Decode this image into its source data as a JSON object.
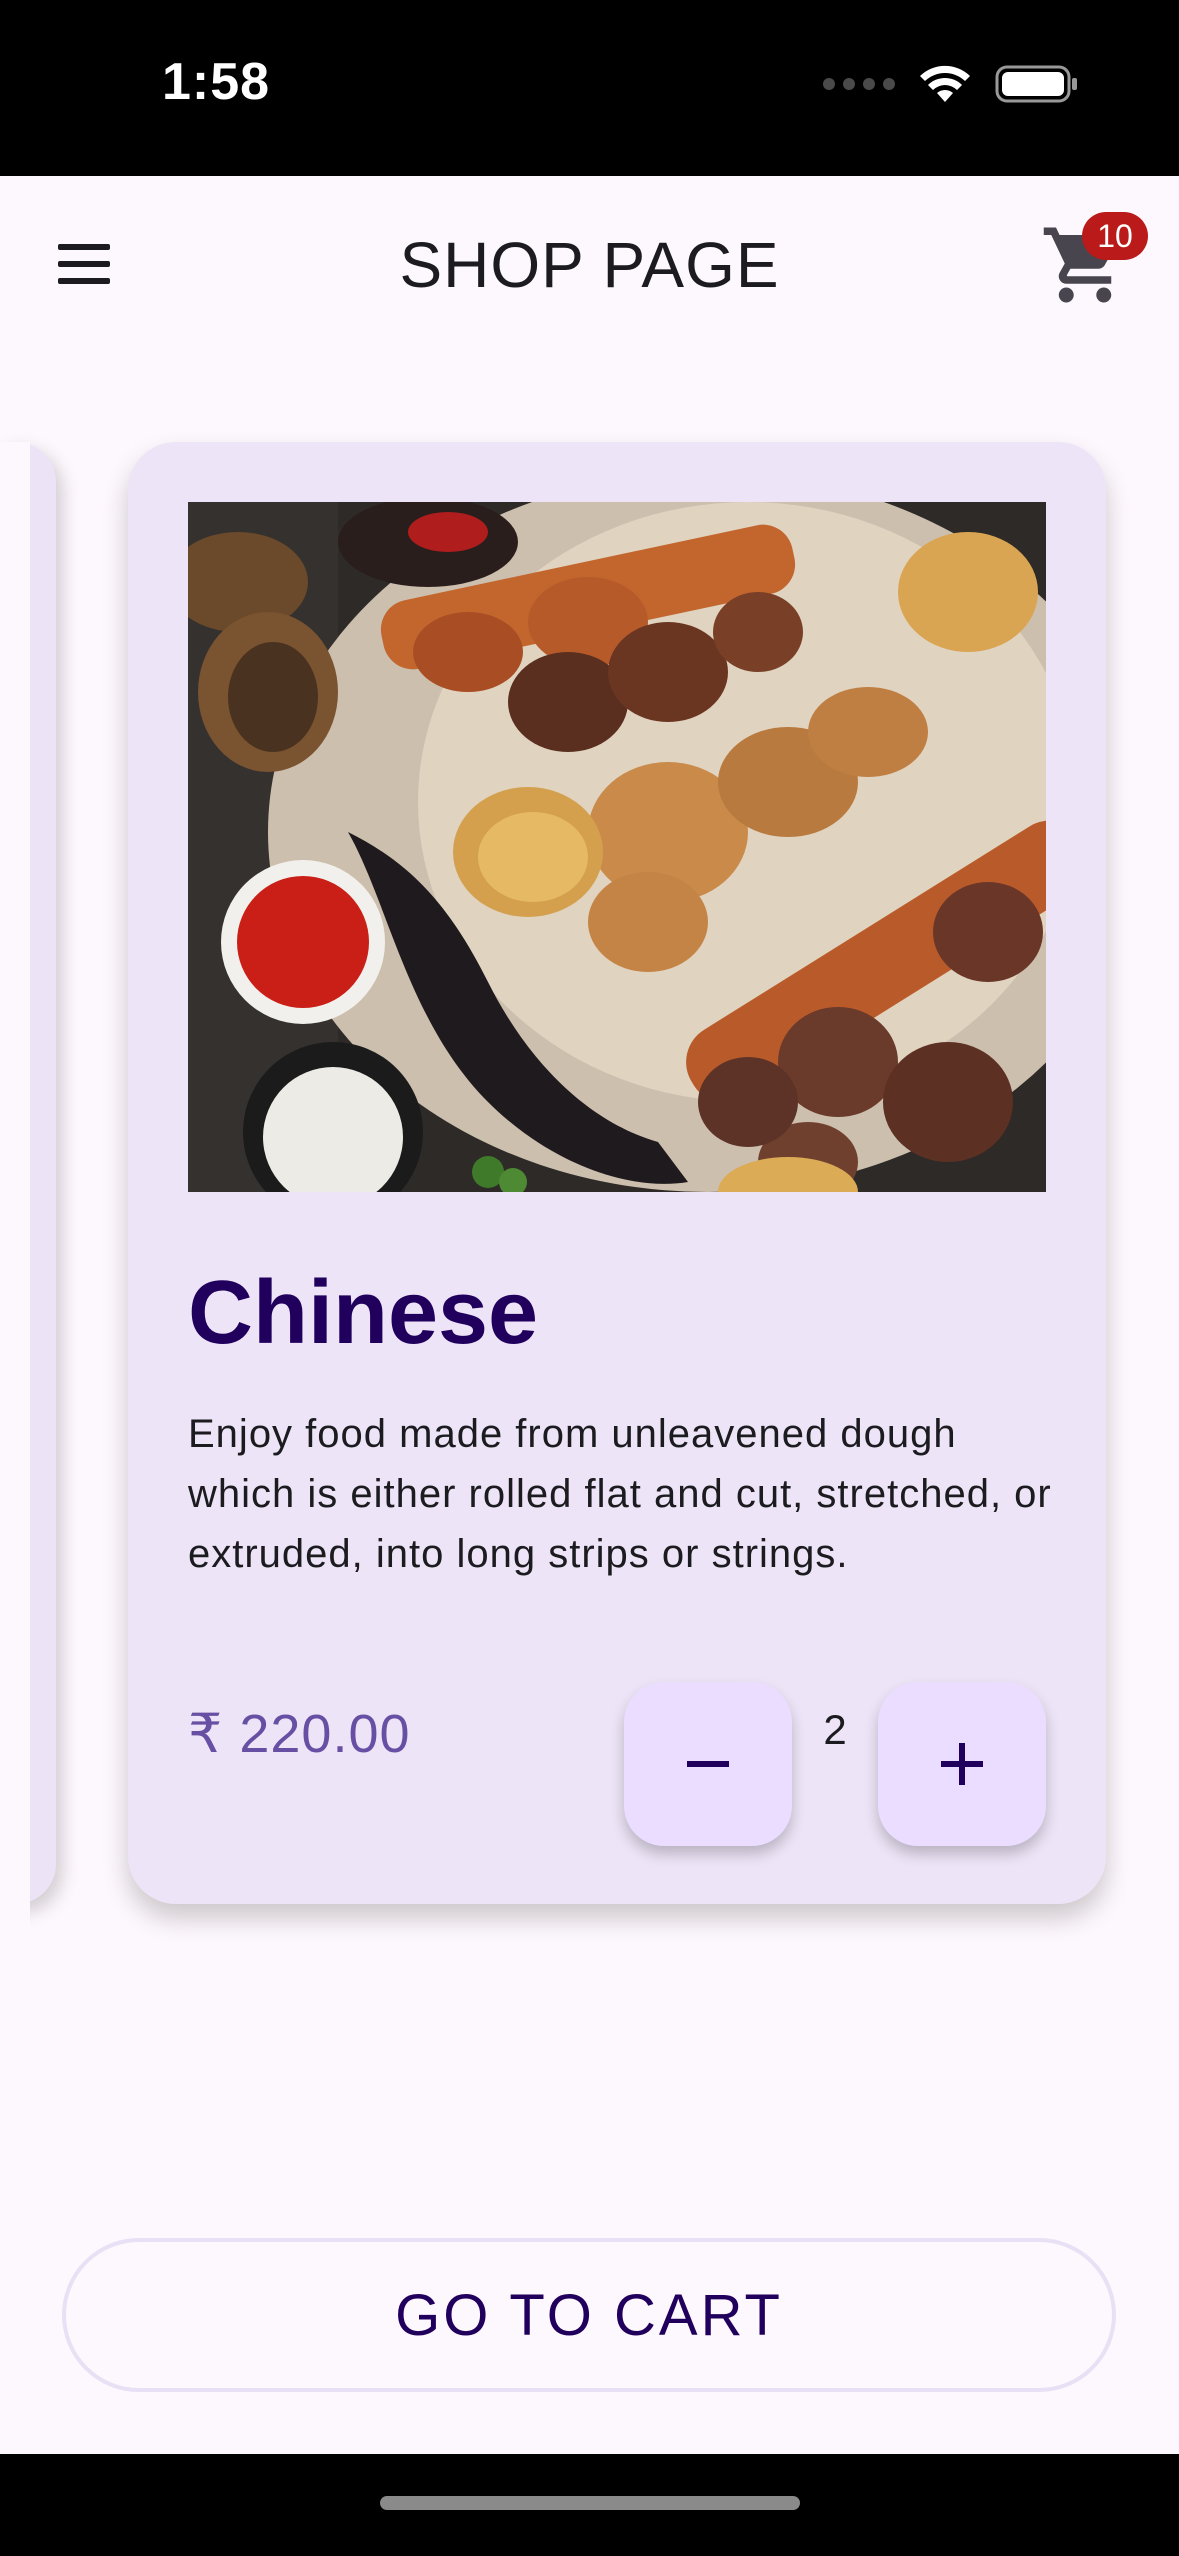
{
  "status_bar": {
    "time": "1:58",
    "icons": [
      "signal-icon",
      "wifi-icon",
      "battery-icon"
    ]
  },
  "app_bar": {
    "title": "SHOP PAGE",
    "menu_icon": "hamburger-menu-icon",
    "cart_icon": "shopping-cart-icon",
    "cart_badge": "10"
  },
  "product": {
    "image_alt": "Grilled kebabs, chicken skewers, potatoes, eggplant with dips",
    "name": "Chinese",
    "description": "Enjoy food made from unleavened dough which is either rolled flat and cut, stretched, or extruded, into long strips or strings.",
    "price": "₹ 220.00",
    "quantity": "2",
    "decrement_icon": "minus-icon",
    "increment_icon": "plus-icon"
  },
  "actions": {
    "go_to_cart": "GO TO CART"
  },
  "colors": {
    "background": "#fdf8fd",
    "card": "#ede5f7",
    "primary_text": "#21005d",
    "price": "#6750a4",
    "qty_button": "#eaddff",
    "badge": "#ba1a1a"
  }
}
